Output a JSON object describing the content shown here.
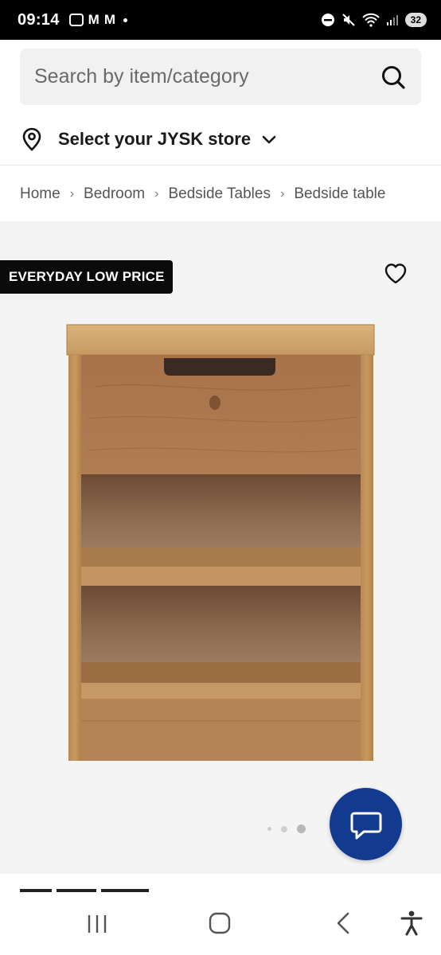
{
  "status_bar": {
    "time": "09:14",
    "battery": "32"
  },
  "search": {
    "placeholder": "Search by item/category"
  },
  "store": {
    "label": "Select your JYSK store"
  },
  "breadcrumb": {
    "items": [
      "Home",
      "Bedroom",
      "Bedside Tables",
      "Bedside table"
    ]
  },
  "product": {
    "badge": "EVERYDAY LOW PRICE",
    "image_count": 3,
    "active_image": 3
  },
  "colors": {
    "badge_bg": "#0b0b0b",
    "chat_button": "#123a8f",
    "image_bg": "#f4f4f4"
  },
  "icons": {
    "search": "search-icon",
    "store": "location-pin-icon",
    "store_toggle": "chevron-down-icon",
    "favorite": "heart-icon",
    "chat": "chat-bubble-icon",
    "nav_recents": "recent-apps-icon",
    "nav_home": "home-icon",
    "nav_back": "back-icon",
    "nav_accessibility": "accessibility-icon"
  }
}
